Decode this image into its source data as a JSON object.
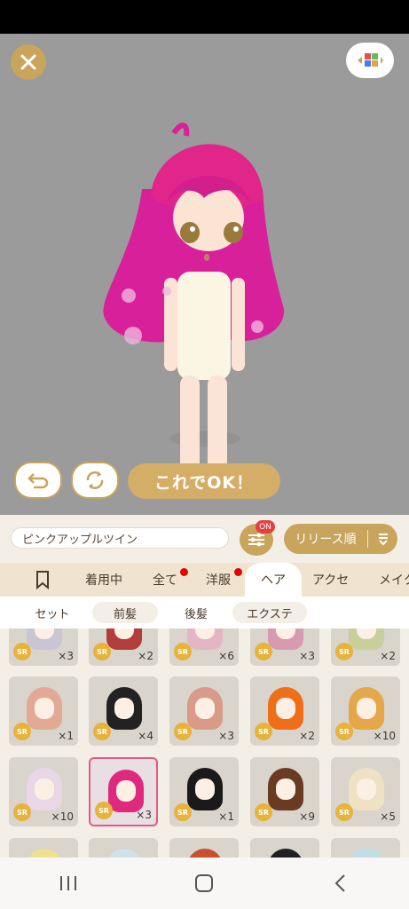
{
  "colors": {
    "accent": "#c9a45c",
    "ok": "#d4ad67",
    "badge": "#e64040",
    "sr": "#e8b33b",
    "selected": "#e05b86"
  },
  "header": {
    "close_icon": "close-icon",
    "view_icon": "color-palette-icon"
  },
  "actions": {
    "undo_icon": "undo-icon",
    "rotate_icon": "rotate-icon",
    "ok_label": "これでOK！"
  },
  "toolbar": {
    "item_name": "ピンクアップルツイン",
    "filter_badge": "ON",
    "sort_label": "リリース順",
    "sort_icon": "sort-order-icon"
  },
  "tabs": [
    {
      "label": "",
      "icon": "bookmark-icon"
    },
    {
      "label": "着用中"
    },
    {
      "label": "全て",
      "dot": true
    },
    {
      "label": "洋服",
      "dot": true
    },
    {
      "label": "ヘア",
      "active": true
    },
    {
      "label": "アクセ"
    },
    {
      "label": "メイク"
    }
  ],
  "subtabs": [
    {
      "label": "セット"
    },
    {
      "label": "前髪"
    },
    {
      "label": "後髪"
    },
    {
      "label": "エクステ"
    }
  ],
  "items": [
    {
      "rarity": "SR",
      "qty": "×3",
      "hair": "#c9c5d4"
    },
    {
      "rarity": "SR",
      "qty": "×2",
      "hair": "#b33c3c"
    },
    {
      "rarity": "SR",
      "qty": "×6",
      "hair": "#e4b6c4"
    },
    {
      "rarity": "SR",
      "qty": "×3",
      "hair": "#d79ab0"
    },
    {
      "rarity": "SR",
      "qty": "×2",
      "hair": "#c9cf9b"
    },
    {
      "rarity": "SR",
      "qty": "×1",
      "hair": "#e2aa95"
    },
    {
      "rarity": "SR",
      "qty": "×4",
      "hair": "#222222"
    },
    {
      "rarity": "SR",
      "qty": "×3",
      "hair": "#d99a88"
    },
    {
      "rarity": "SR",
      "qty": "×2",
      "hair": "#ee6f18"
    },
    {
      "rarity": "SR",
      "qty": "×10",
      "hair": "#e4a84a"
    },
    {
      "rarity": "SR",
      "qty": "×10",
      "hair": "#e9d6e6"
    },
    {
      "rarity": "SR",
      "qty": "×3",
      "hair": "#e0287e",
      "selected": true
    },
    {
      "rarity": "SR",
      "qty": "×1",
      "hair": "#1a1a1a"
    },
    {
      "rarity": "SR",
      "qty": "×9",
      "hair": "#6b3a22"
    },
    {
      "rarity": "SR",
      "qty": "×5",
      "hair": "#efe2c4"
    },
    {
      "rarity": "",
      "qty": "",
      "hair": "#efe08e"
    },
    {
      "rarity": "",
      "qty": "",
      "hair": "#cfe2e8"
    },
    {
      "rarity": "",
      "qty": "",
      "hair": "#c9502f"
    },
    {
      "rarity": "",
      "qty": "",
      "hair": "#202020"
    },
    {
      "rarity": "",
      "qty": "",
      "hair": "#bfdde4"
    }
  ],
  "navbar": {
    "recents_icon": "recent-apps-icon",
    "home_icon": "home-icon",
    "back_icon": "back-icon"
  }
}
